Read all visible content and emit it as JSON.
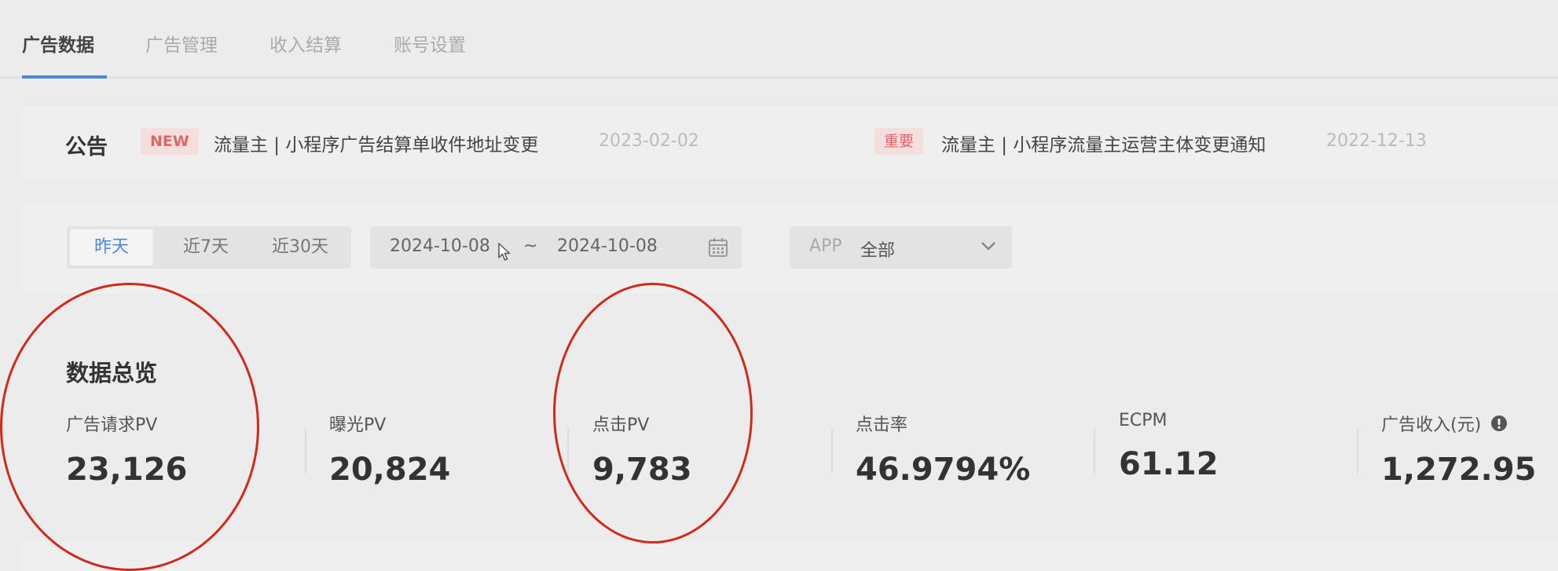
{
  "nav": {
    "tabs": [
      {
        "label": "广告数据",
        "active": true
      },
      {
        "label": "广告管理",
        "active": false
      },
      {
        "label": "收入结算",
        "active": false
      },
      {
        "label": "账号设置",
        "active": false
      }
    ]
  },
  "notice": {
    "title": "公告",
    "items": [
      {
        "badge": "NEW",
        "text": "流量主 | 小程序广告结算单收件地址变更",
        "date": "2023-02-02"
      },
      {
        "badge": "重要",
        "text": "流量主 | 小程序流量主运营主体变更通知",
        "date": "2022-12-13"
      }
    ]
  },
  "filter": {
    "ranges": [
      {
        "label": "昨天",
        "active": true
      },
      {
        "label": "近7天",
        "active": false
      },
      {
        "label": "近30天",
        "active": false
      }
    ],
    "start_date": "2024-10-08",
    "separator": "~",
    "end_date": "2024-10-08",
    "app_label": "APP",
    "app_value": "全部"
  },
  "overview": {
    "title": "数据总览",
    "metrics": [
      {
        "label": "广告请求PV",
        "value": "23,126"
      },
      {
        "label": "曝光PV",
        "value": "20,824"
      },
      {
        "label": "点击PV",
        "value": "9,783"
      },
      {
        "label": "点击率",
        "value": "46.9794%"
      },
      {
        "label": "ECPM",
        "value": "61.12"
      },
      {
        "label": "广告收入(元)",
        "value": "1,272.95"
      }
    ]
  },
  "colors": {
    "accent": "#4a88e4",
    "badge_text": "#e06565",
    "annotation": "#cf2a1c"
  },
  "icons": [
    "calendar-icon",
    "chevron-down-icon",
    "info-icon",
    "cursor-icon"
  ]
}
